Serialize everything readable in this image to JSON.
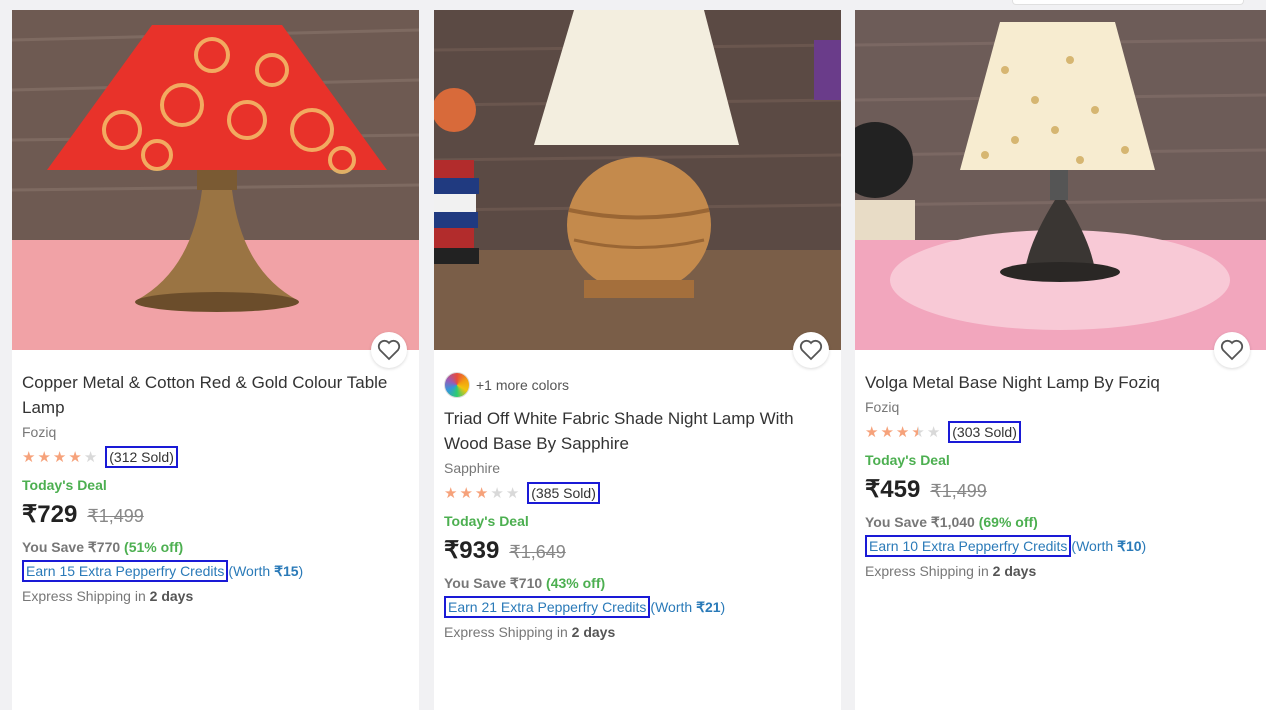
{
  "products": [
    {
      "title": "Copper Metal & Cotton Red & Gold Colour Table Lamp",
      "brand": "Foziq",
      "rating": 4,
      "sold": "(312 Sold)",
      "deal": "Today's Deal",
      "price": "₹729",
      "mrp": "₹1,499",
      "save_text": "You Save ₹770",
      "save_pct": "(51% off)",
      "credits": "Earn 15 Extra Pepperfry Credits",
      "worth_prefix": "(Worth ",
      "worth_value": "₹15",
      "worth_suffix": ")",
      "ship_text": "Express Shipping in ",
      "ship_days": "2 days"
    },
    {
      "more_colors": "+1 more colors",
      "title": "Triad Off White Fabric Shade Night Lamp With Wood Base By Sapphire",
      "brand": "Sapphire",
      "rating": 3,
      "sold": "(385 Sold)",
      "deal": "Today's Deal",
      "price": "₹939",
      "mrp": "₹1,649",
      "save_text": "You Save ₹710",
      "save_pct": "(43% off)",
      "credits": "Earn 21 Extra Pepperfry Credits",
      "worth_prefix": "(Worth ",
      "worth_value": "₹21",
      "worth_suffix": ")",
      "ship_text": "Express Shipping in ",
      "ship_days": "2 days"
    },
    {
      "title": "Volga Metal Base Night Lamp By Foziq",
      "brand": "Foziq",
      "rating": 3.5,
      "sold": "(303 Sold)",
      "deal": "Today's Deal",
      "price": "₹459",
      "mrp": "₹1,499",
      "save_text": "You Save ₹1,040",
      "save_pct": "(69% off)",
      "credits": "Earn 10 Extra Pepperfry Credits",
      "worth_prefix": "(Worth ",
      "worth_value": "₹10",
      "worth_suffix": ")",
      "ship_text": "Express Shipping in ",
      "ship_days": "2 days"
    }
  ],
  "icons": {
    "wishlist": "heart-icon",
    "star": "star-icon",
    "colors": "color-wheel-icon"
  },
  "colors": {
    "accent_link": "#2a7ab8",
    "deal_green": "#4caf50",
    "star_on": "#f6a27b",
    "highlight_box": "#1a1ad6"
  }
}
